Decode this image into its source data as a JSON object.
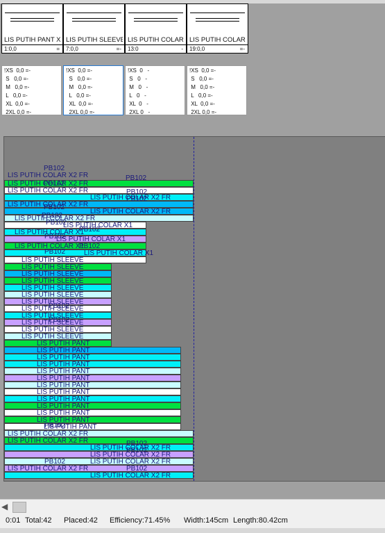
{
  "cards": [
    {
      "name": "LIS PUTIH PANT XS",
      "placed": "1:0,0",
      "mark": "="
    },
    {
      "name": "LIS PUTIH SLEEVE",
      "placed": "7:0,0",
      "mark": "=-"
    },
    {
      "name": "LIS PUTIH  COLAR",
      "placed": "13:0",
      "mark": "-"
    },
    {
      "name": "LIS PUTIH  COLAR",
      "placed": "19:0,0",
      "mark": "=-"
    }
  ],
  "size_tables": [
    [
      "!XS  0,0 =-",
      " S   0,0 =-",
      " M   0,0 =-",
      " L   0,0 =-",
      " XL  0,0 =-",
      " 2XL 0,0 =-"
    ],
    [
      "!XS  0,0 =-",
      "  S   0,0 =-",
      "  M   0,0 =-",
      "  L   0,0 =-",
      "  XL  0,0 =-",
      "  2XL 0,0 =-"
    ],
    [
      "!XS  0   -",
      " S   0   -",
      " M   0   -",
      " L   0   -",
      " XL  0   -",
      " 2XL 0   -"
    ],
    [
      "!XS  0,0 =-",
      " S   0,0 =-",
      " M   0,0 =-",
      " L   0,0 =-",
      " XL  0,0 =-",
      " 2XL 0,0 =-"
    ]
  ],
  "marker": {
    "code": "PB102",
    "labels": {
      "colar_x2": "LIS PUTIH  COLAR X2  FR",
      "colar_x1": "LIS PUTIH  COLAR X1",
      "sleeve": "LIS PUTIH SLEEVE",
      "pant": "LIS PUTIH PANT"
    },
    "colors": {
      "green": "#00e040",
      "cyan": "#00f0f8",
      "blue": "#00b8f8",
      "lightcyan": "#c8fcff",
      "violet": "#c8a0ff",
      "white": "#ffffff"
    }
  },
  "status": {
    "time": "0:01",
    "total": "Total:42",
    "placed": "Placed:42",
    "efficiency": "Efficiency:71.45%",
    "width": "Width:145cm",
    "length": "Length:80.42cm"
  }
}
